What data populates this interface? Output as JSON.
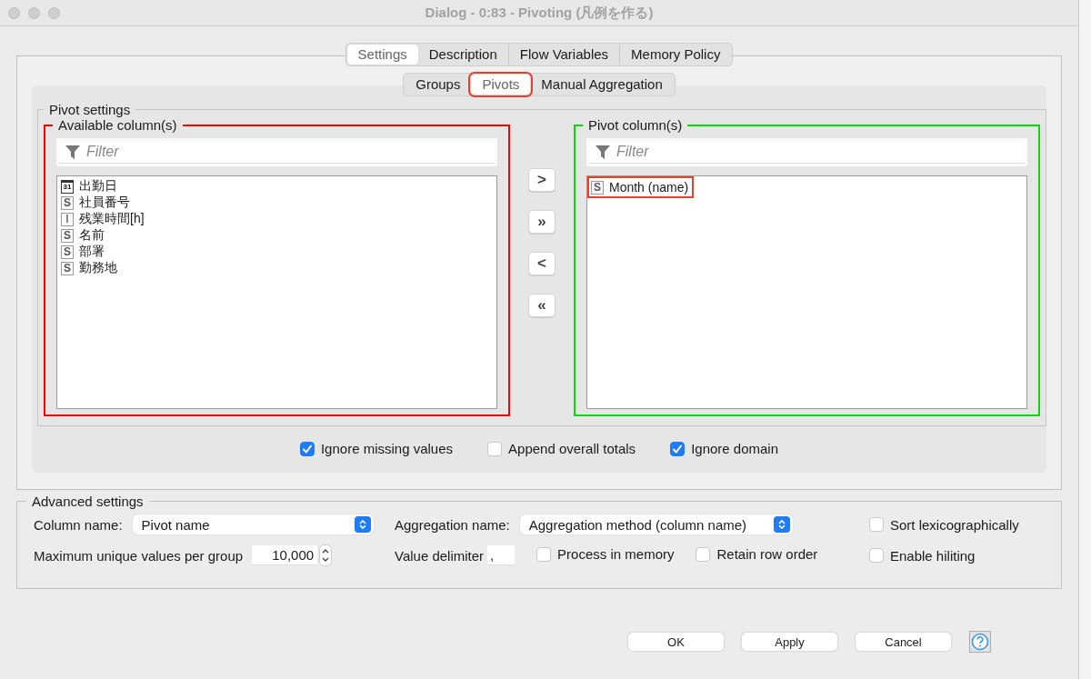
{
  "window": {
    "title": "Dialog - 0:83 - Pivoting (凡例を作る)"
  },
  "tabs": [
    {
      "label": "Settings",
      "selected": true
    },
    {
      "label": "Description",
      "selected": false
    },
    {
      "label": "Flow Variables",
      "selected": false
    },
    {
      "label": "Memory Policy",
      "selected": false
    }
  ],
  "subtabs": [
    {
      "label": "Groups",
      "selected": false,
      "highlighted": false
    },
    {
      "label": "Pivots",
      "selected": true,
      "highlighted": true
    },
    {
      "label": "Manual Aggregation",
      "selected": false,
      "highlighted": false
    }
  ],
  "pivot_settings": {
    "title": "Pivot settings",
    "available": {
      "title": "Available column(s)",
      "color": "#ff0000",
      "filter_placeholder": "Filter",
      "items": [
        {
          "kind": "date",
          "icon_label": "31",
          "name": "出勤日",
          "highlighted": false
        },
        {
          "kind": "string",
          "icon_label": "S",
          "name": "社員番号",
          "highlighted": false
        },
        {
          "kind": "integer",
          "icon_label": "I",
          "name": "残業時間[h]",
          "highlighted": false
        },
        {
          "kind": "string",
          "icon_label": "S",
          "name": "名前",
          "highlighted": false
        },
        {
          "kind": "string",
          "icon_label": "S",
          "name": "部署",
          "highlighted": false
        },
        {
          "kind": "string",
          "icon_label": "S",
          "name": "勤務地",
          "highlighted": false
        }
      ]
    },
    "move_buttons": [
      ">",
      "»",
      "<",
      "«"
    ],
    "pivot": {
      "title": "Pivot column(s)",
      "color": "#00dd00",
      "filter_placeholder": "Filter",
      "items": [
        {
          "kind": "string",
          "icon_label": "S",
          "name": "Month (name)",
          "highlighted": true
        }
      ]
    }
  },
  "options": [
    {
      "label": "Ignore missing values",
      "checked": true
    },
    {
      "label": "Append overall totals",
      "checked": false
    },
    {
      "label": "Ignore domain",
      "checked": true
    }
  ],
  "advanced": {
    "title": "Advanced settings",
    "column_name": {
      "label": "Column name:",
      "value": "Pivot name"
    },
    "aggregation_name": {
      "label": "Aggregation name:",
      "value": "Aggregation method (column name)"
    },
    "max_unique": {
      "label": "Maximum unique values per group",
      "value": "10,000"
    },
    "value_delimiter": {
      "label": "Value delimiter",
      "value": ","
    },
    "checkboxes": [
      {
        "label": "Sort lexicographically",
        "checked": false
      },
      {
        "label": "Process in memory",
        "checked": false
      },
      {
        "label": "Retain row order",
        "checked": false
      },
      {
        "label": "Enable hiliting",
        "checked": false
      }
    ]
  },
  "buttons": [
    "OK",
    "Apply",
    "Cancel"
  ]
}
